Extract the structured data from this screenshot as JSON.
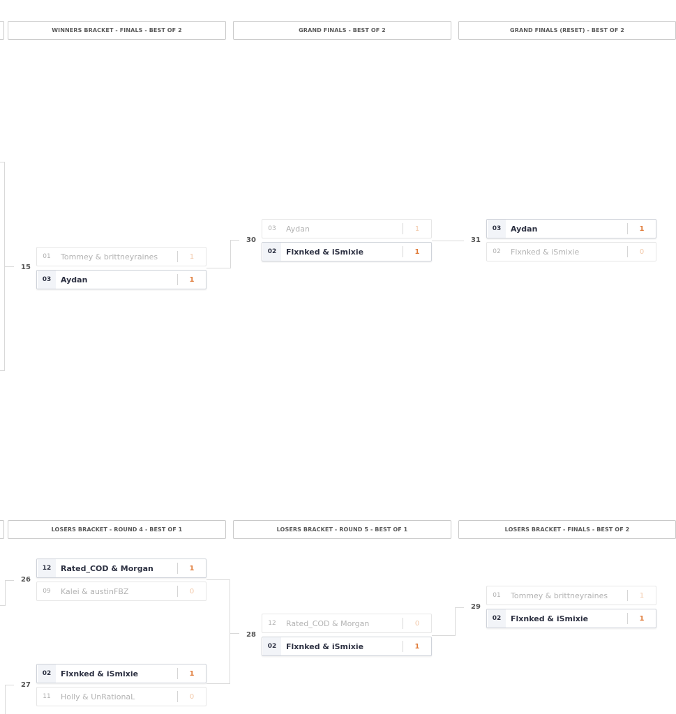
{
  "headers": {
    "top": [
      "WINNERS BRACKET - FINALS - BEST OF 2",
      "GRAND FINALS - BEST OF 2",
      "GRAND FINALS (RESET) - BEST OF 2"
    ],
    "bottom": [
      "LOSERS BRACKET - ROUND 4 - BEST OF 1",
      "LOSERS BRACKET - ROUND 5 - BEST OF 1",
      "LOSERS BRACKET - FINALS - BEST OF 2"
    ]
  },
  "matches": {
    "m15": {
      "number": "15",
      "slots": [
        {
          "seed": "01",
          "name": "Tommey & brittneyraines",
          "score": "1",
          "winner": false
        },
        {
          "seed": "03",
          "name": "Aydan",
          "score": "1",
          "winner": true
        }
      ]
    },
    "m30": {
      "number": "30",
      "slots": [
        {
          "seed": "03",
          "name": "Aydan",
          "score": "1",
          "winner": false
        },
        {
          "seed": "02",
          "name": "Flxnked & iSmixie",
          "score": "1",
          "winner": true
        }
      ]
    },
    "m31": {
      "number": "31",
      "slots": [
        {
          "seed": "03",
          "name": "Aydan",
          "score": "1",
          "winner": true
        },
        {
          "seed": "02",
          "name": "Flxnked & iSmixie",
          "score": "0",
          "winner": false
        }
      ]
    },
    "m26": {
      "number": "26",
      "slots": [
        {
          "seed": "12",
          "name": "Rated_COD & Morgan",
          "score": "1",
          "winner": true
        },
        {
          "seed": "09",
          "name": "Kalei & austinFBZ",
          "score": "0",
          "winner": false
        }
      ]
    },
    "m27": {
      "number": "27",
      "slots": [
        {
          "seed": "02",
          "name": "Flxnked & iSmixie",
          "score": "1",
          "winner": true
        },
        {
          "seed": "11",
          "name": "Holly & UnRationaL",
          "score": "0",
          "winner": false
        }
      ]
    },
    "m28": {
      "number": "28",
      "slots": [
        {
          "seed": "12",
          "name": "Rated_COD & Morgan",
          "score": "0",
          "winner": false
        },
        {
          "seed": "02",
          "name": "Flxnked & iSmixie",
          "score": "1",
          "winner": true
        }
      ]
    },
    "m29": {
      "number": "29",
      "slots": [
        {
          "seed": "01",
          "name": "Tommey & brittneyraines",
          "score": "1",
          "winner": false
        },
        {
          "seed": "02",
          "name": "Flxnked & iSmixie",
          "score": "1",
          "winner": true
        }
      ]
    }
  }
}
